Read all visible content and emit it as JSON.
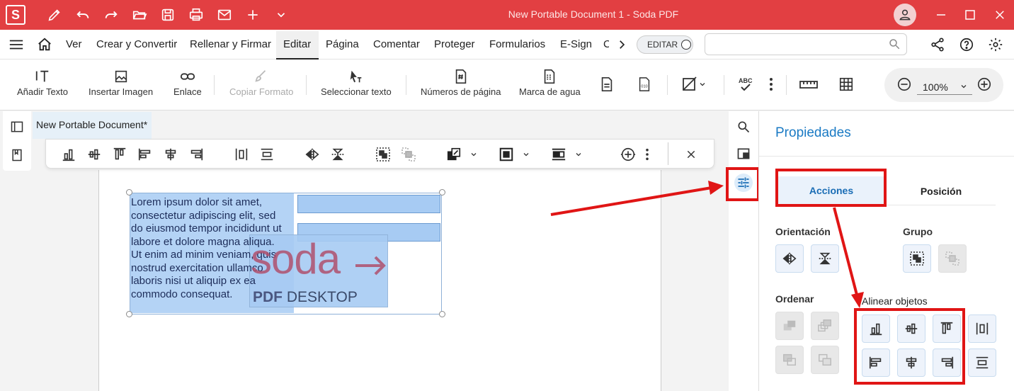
{
  "window": {
    "title": "New Portable Document 1   -   Soda PDF",
    "logo_letter": "S"
  },
  "menu": {
    "items": [
      "Ver",
      "Crear y Convertir",
      "Rellenar y Firmar",
      "Editar",
      "Página",
      "Comentar",
      "Proteger",
      "Formularios",
      "E-Sign",
      "C"
    ],
    "active": "Editar",
    "edit_toggle_label": "EDITAR",
    "search_placeholder": ""
  },
  "ribbon": {
    "add_text": "Añadir Texto",
    "insert_image": "Insertar Imagen",
    "link": "Enlace",
    "copy_format": "Copiar Formato",
    "select_text": "Seleccionar texto",
    "page_numbers": "Números de página",
    "watermark": "Marca de agua",
    "zoom_value": "100%"
  },
  "document": {
    "tab_title": "New Portable Document*",
    "lorem_lines": [
      "Lorem ipsum dolor sit amet,",
      "consectetur adipiscing elit, sed",
      "do eiusmod tempor incididunt ut",
      "labore et dolore magna aliqua.",
      "Ut enim ad minim veniam, quis",
      "nostrud exercitation ullamco",
      "laboris nisi ut aliquip ex ea",
      "commodo consequat."
    ],
    "logo_word": "soda",
    "logo_sub_bold": "PDF",
    "logo_sub": "DESKTOP",
    "colors": {
      "logo": "#b0506e",
      "selection": "#a7cbf3",
      "accent": "#e23f42"
    }
  },
  "panel": {
    "title": "Propiedades",
    "tabs": [
      "Acciones",
      "Posición"
    ],
    "active_tab": "Acciones",
    "orientation_label": "Orientación",
    "group_label": "Grupo",
    "order_label": "Ordenar",
    "align_label": "Alinear objetos",
    "accent_color": "#1a7ac4",
    "highlight_color": "#e01515"
  }
}
